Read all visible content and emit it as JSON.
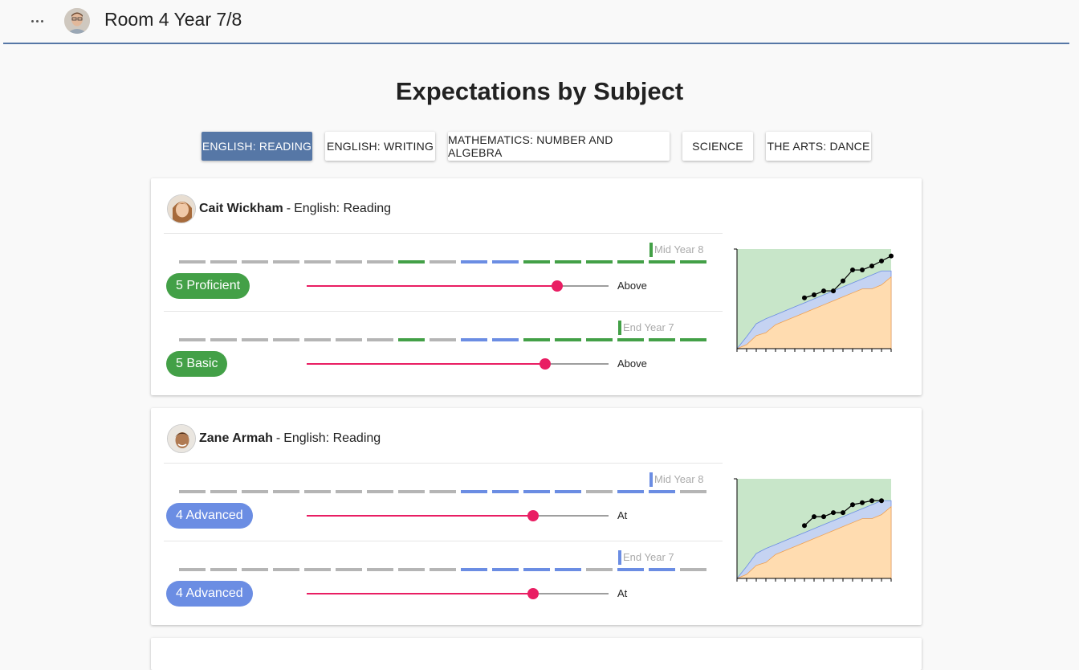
{
  "header": {
    "title": "Room 4 Year 7/8"
  },
  "page_title": "Expectations by Subject",
  "colors": {
    "green": "#43a047",
    "blue": "#6b8de3",
    "grey": "#b5b5b5",
    "slider": "#e91e63",
    "nav": "#5677a6"
  },
  "tabs": [
    {
      "label": "English: Reading",
      "active": true
    },
    {
      "label": "English: Writing",
      "active": false
    },
    {
      "label": "Mathematics: Number and Algebra",
      "active": false
    },
    {
      "label": "Science",
      "active": false
    },
    {
      "label": "The Arts: Dance",
      "active": false
    }
  ],
  "students": [
    {
      "name": "Cait Wickham",
      "separator": "-",
      "subject": "English: Reading",
      "rows": [
        {
          "period": "Mid Year 8",
          "level": "5 Proficient",
          "level_color": "green",
          "relative": "Above",
          "slider_fraction": 0.83,
          "segments": [
            "grey",
            "grey",
            "grey",
            "grey",
            "grey",
            "grey",
            "grey",
            "green",
            "grey",
            "blue",
            "blue",
            "green",
            "green",
            "green",
            "green",
            "green",
            "green"
          ]
        },
        {
          "period": "End Year 7",
          "level": "5 Basic",
          "level_color": "green",
          "relative": "Above",
          "slider_fraction": 0.79,
          "segments": [
            "grey",
            "grey",
            "grey",
            "grey",
            "grey",
            "grey",
            "grey",
            "green",
            "grey",
            "blue",
            "blue",
            "green",
            "green",
            "green",
            "green",
            "green",
            "green"
          ]
        }
      ]
    },
    {
      "name": "Zane Armah",
      "separator": "-",
      "subject": "English: Reading",
      "rows": [
        {
          "period": "Mid Year 8",
          "level": "4 Advanced",
          "level_color": "blue",
          "relative": "At",
          "slider_fraction": 0.75,
          "segments": [
            "grey",
            "grey",
            "grey",
            "grey",
            "grey",
            "grey",
            "grey",
            "grey",
            "grey",
            "blue",
            "blue",
            "blue",
            "blue",
            "grey",
            "blue",
            "blue",
            "grey"
          ]
        },
        {
          "period": "End Year 7",
          "level": "4 Advanced",
          "level_color": "blue",
          "relative": "At",
          "slider_fraction": 0.75,
          "segments": [
            "grey",
            "grey",
            "grey",
            "grey",
            "grey",
            "grey",
            "grey",
            "grey",
            "grey",
            "blue",
            "blue",
            "blue",
            "blue",
            "grey",
            "blue",
            "blue",
            "grey"
          ]
        }
      ]
    }
  ],
  "chart_data": [
    {
      "type": "area",
      "student": "Cait Wickham",
      "x": [
        0,
        1,
        2,
        3,
        4,
        5,
        6,
        7,
        8,
        9,
        10,
        11,
        12,
        13,
        14,
        15,
        16
      ],
      "bands": {
        "lower": "orange",
        "middle": "blue",
        "upper": "green"
      },
      "points": [
        null,
        null,
        null,
        null,
        null,
        null,
        null,
        5.1,
        5.4,
        5.8,
        5.8,
        6.8,
        7.9,
        7.9,
        8.3,
        8.8,
        9.3
      ]
    },
    {
      "type": "area",
      "student": "Zane Armah",
      "x": [
        0,
        1,
        2,
        3,
        4,
        5,
        6,
        7,
        8,
        9,
        10,
        11,
        12,
        13,
        14,
        15,
        16
      ],
      "bands": {
        "lower": "orange",
        "middle": "blue",
        "upper": "green"
      },
      "points": [
        null,
        null,
        null,
        null,
        null,
        null,
        null,
        5.3,
        6.2,
        6.2,
        6.6,
        6.6,
        7.4,
        7.6,
        7.8,
        7.8,
        null
      ]
    }
  ]
}
